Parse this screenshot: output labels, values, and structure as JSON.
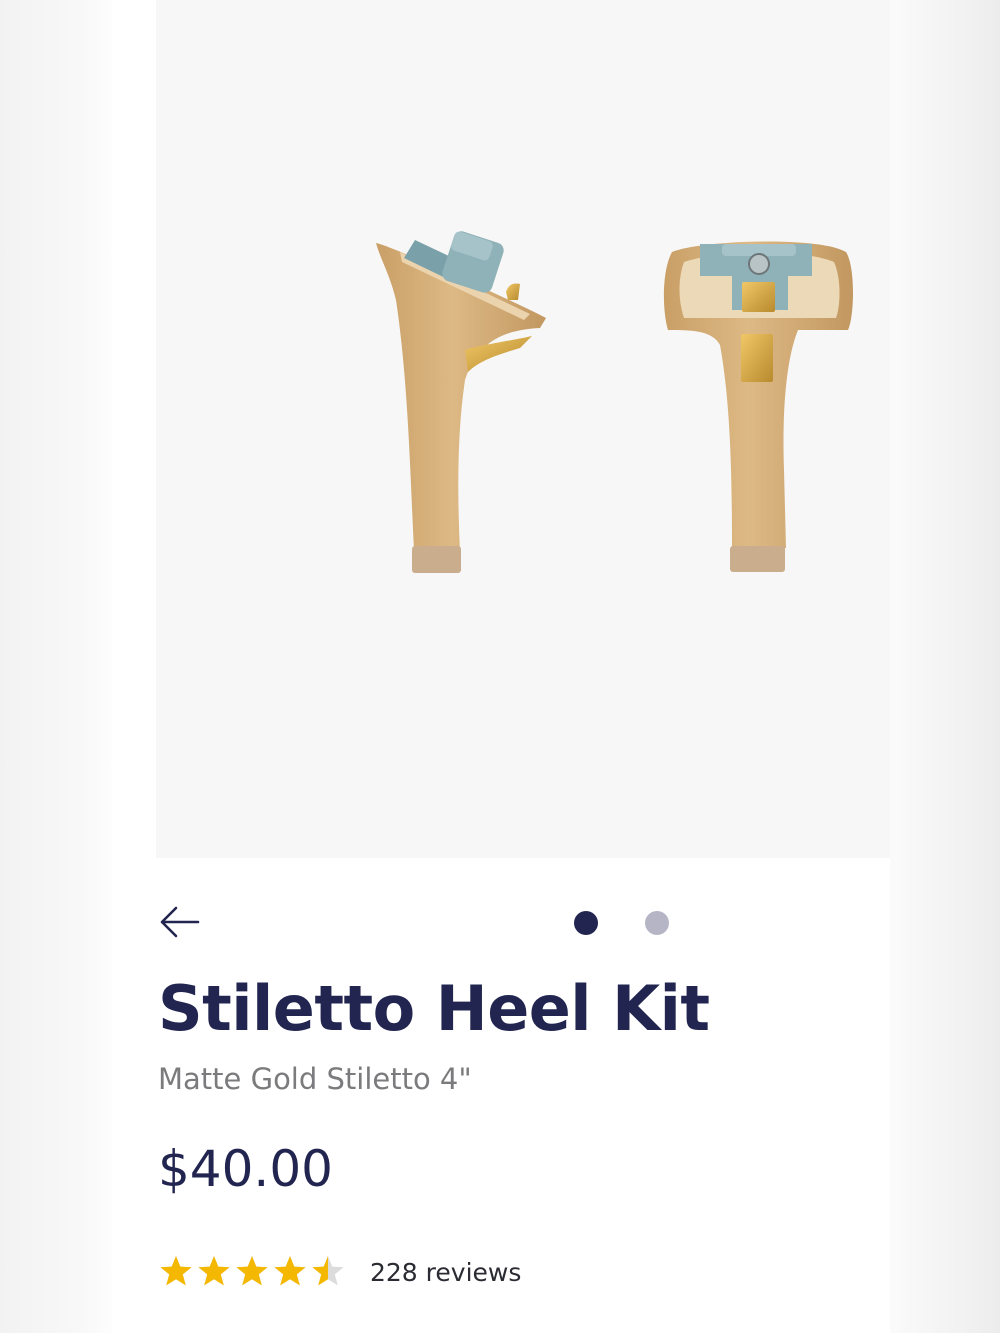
{
  "product": {
    "title": "Stiletto Heel Kit",
    "variant": "Matte Gold Stiletto 4\"",
    "price": "$40.00",
    "rating": 4.5,
    "rating_max": 5,
    "reviews_label": "228 reviews"
  },
  "carousel": {
    "total_slides": 2,
    "active_index": 0
  },
  "icons": {
    "back": "arrow-left-icon",
    "star": "star-icon"
  },
  "colors": {
    "brand_navy": "#22254f",
    "dot_inactive": "#b6b5c6",
    "star_gold": "#f5b800",
    "heel_tan": "#d6b07a",
    "cap_teal": "#8fb1b8"
  }
}
